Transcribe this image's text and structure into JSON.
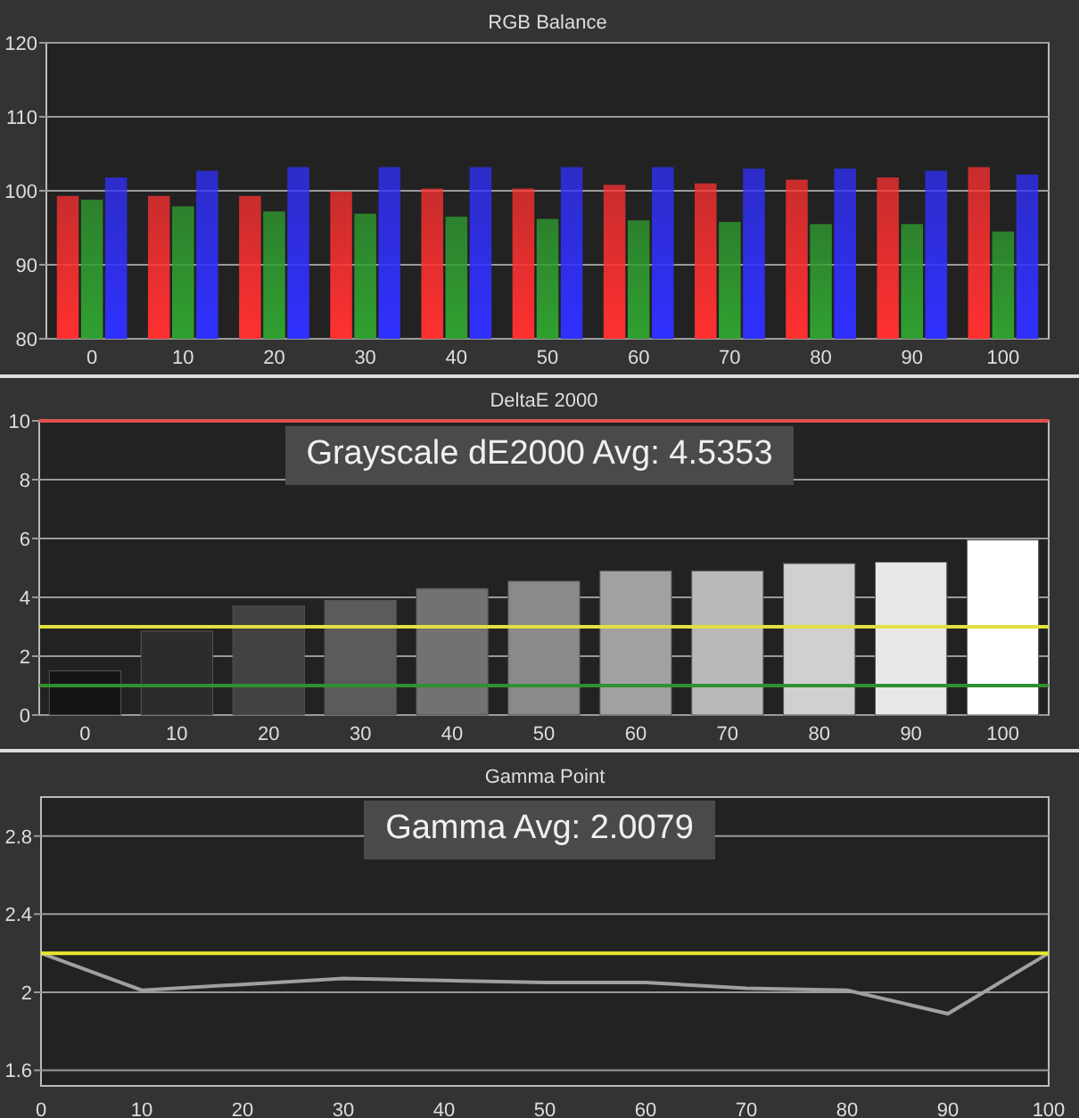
{
  "panels": [
    {
      "chart_data": {
        "type": "bar",
        "title": "RGB Balance",
        "categories": [
          "0",
          "10",
          "20",
          "30",
          "40",
          "50",
          "60",
          "70",
          "80",
          "90",
          "100"
        ],
        "ylim": [
          80,
          120
        ],
        "yticks": [
          80,
          90,
          100,
          110,
          120
        ],
        "grid": true,
        "series": [
          {
            "color": "#ff3030",
            "values": [
              99.3,
              99.3,
              99.3,
              99.9,
              100.3,
              100.3,
              100.8,
              101,
              101.5,
              101.8,
              103.2
            ]
          },
          {
            "color": "#30a030",
            "values": [
              98.8,
              97.9,
              97.2,
              96.9,
              96.5,
              96.2,
              96,
              95.8,
              95.5,
              95.5,
              94.5
            ]
          },
          {
            "color": "#3030ff",
            "values": [
              101.8,
              102.7,
              103.2,
              103.2,
              103.2,
              103.2,
              103.2,
              103,
              103,
              102.7,
              102.2
            ]
          }
        ]
      }
    },
    {
      "average_label": "Grayscale dE2000 Avg: 4.5353",
      "chart_data": {
        "type": "bar",
        "title": "DeltaE 2000",
        "categories": [
          "0",
          "10",
          "20",
          "30",
          "40",
          "50",
          "60",
          "70",
          "80",
          "90",
          "100"
        ],
        "ylim": [
          0,
          10
        ],
        "yticks": [
          0,
          2,
          4,
          6,
          8,
          10
        ],
        "grid": true,
        "series": [
          {
            "values": [
              1.5,
              2.85,
              3.7,
              3.9,
              4.3,
              4.55,
              4.9,
              4.9,
              5.15,
              5.2,
              5.95
            ]
          }
        ],
        "ref_lines": [
          {
            "axis": "y",
            "value": 10,
            "color": "#e05050"
          },
          {
            "axis": "y",
            "value": 3,
            "color": "#e0e040"
          },
          {
            "axis": "y",
            "value": 1,
            "color": "#309030"
          }
        ]
      }
    },
    {
      "average_label": "Gamma Avg: 2.0079",
      "chart_data": {
        "type": "line",
        "title": "Gamma Point",
        "x": [
          0,
          10,
          20,
          30,
          40,
          50,
          60,
          70,
          80,
          90,
          100
        ],
        "xlim": [
          0,
          100
        ],
        "xticks": [
          0,
          10,
          20,
          30,
          40,
          50,
          60,
          70,
          80,
          90,
          100
        ],
        "ylim": [
          1.52,
          3.0
        ],
        "yticks": [
          1.6,
          {
            "value": 2,
            "label": "2"
          },
          2.4,
          2.8
        ],
        "grid": true,
        "series": [
          {
            "color": "#a0a0a0",
            "values": [
              2.2,
              2.01,
              2.04,
              2.07,
              2.06,
              2.05,
              2.05,
              2.02,
              2.01,
              1.89,
              2.2
            ]
          }
        ],
        "ref_lines": [
          {
            "axis": "y",
            "value": 2.2,
            "color": "#e8e830"
          }
        ]
      }
    }
  ]
}
